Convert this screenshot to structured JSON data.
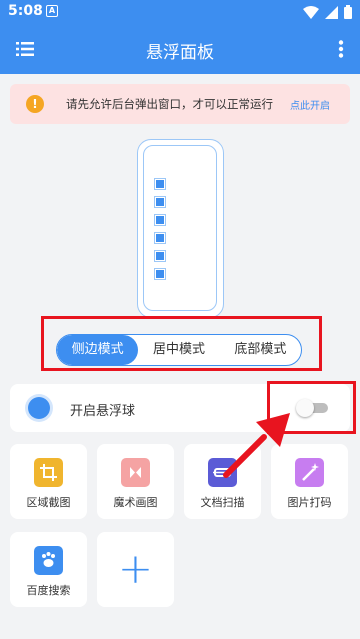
{
  "status_bar": {
    "time": "5:08",
    "notification_icon": "A"
  },
  "app_bar": {
    "title": "悬浮面板",
    "menu_icon": "list-icon",
    "more_icon": "more-vert-icon"
  },
  "notice": {
    "message": "请先允许后台弹出窗口，才可以正常运行",
    "action": "点此开启",
    "icon": "warning-icon"
  },
  "modes": {
    "options": [
      "侧边模式",
      "居中模式",
      "底部模式"
    ],
    "selected_index": 0
  },
  "float_ball": {
    "label": "开启悬浮球",
    "enabled": false
  },
  "tools": [
    {
      "label": "区域截图",
      "icon": "crop-icon",
      "color": "#f0b52e"
    },
    {
      "label": "魔术画图",
      "icon": "magic-draw-icon",
      "color": "#f5a3a3"
    },
    {
      "label": "文档扫描",
      "icon": "scan-icon",
      "color": "#5b5bd6"
    },
    {
      "label": "图片打码",
      "icon": "magic-wand-icon",
      "color": "#c77df0"
    },
    {
      "label": "百度搜索",
      "icon": "baidu-paw-icon",
      "color": "#3d8ef0"
    }
  ],
  "add_tool": {
    "icon": "plus-icon"
  },
  "colors": {
    "primary": "#3d8ef0",
    "notice_bg": "#fde2e2",
    "highlight": "#e8141f"
  }
}
